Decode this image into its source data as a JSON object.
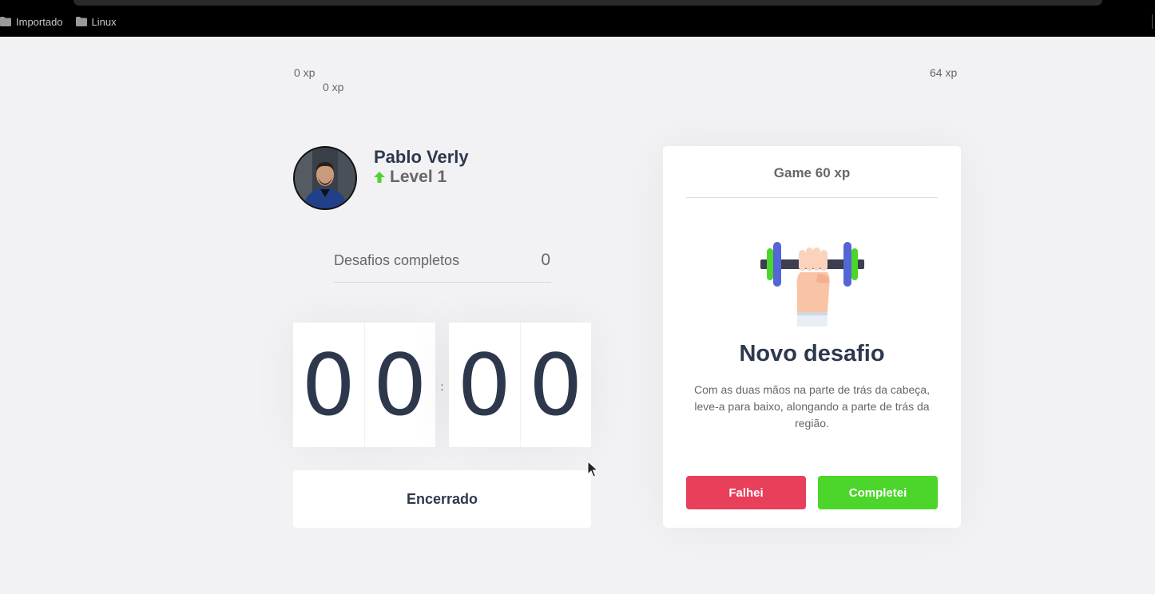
{
  "browser": {
    "bookmarks": [
      {
        "label": "Importado",
        "icon": "folder-icon"
      },
      {
        "label": "Linux",
        "icon": "folder-icon"
      }
    ]
  },
  "xp": {
    "min_label": "0 xp",
    "current_label": "0 xp",
    "max_label": "64 xp",
    "progress": 0
  },
  "profile": {
    "name": "Pablo Verly",
    "level_label": "Level 1",
    "level_icon": "level-up-arrow-icon"
  },
  "completed": {
    "label": "Desafios completos",
    "value": "0"
  },
  "countdown": {
    "minute_left": "0",
    "minute_right": "0",
    "separator": ":",
    "second_left": "0",
    "second_right": "0"
  },
  "cycle_button": {
    "label": "Encerrado"
  },
  "challenge": {
    "header": "Game 60 xp",
    "icon": "dumbbell-hand-icon",
    "title": "Novo desafio",
    "description": "Com as duas mãos na parte de trás da cabeça, leve-a para baixo, alongando a parte de trás da região.",
    "fail_label": "Falhei",
    "complete_label": "Completei"
  },
  "colors": {
    "fail": "#e83f5b",
    "success": "#4cd62b",
    "title": "#2e384d",
    "text": "#666666",
    "background": "#f2f2f4"
  }
}
